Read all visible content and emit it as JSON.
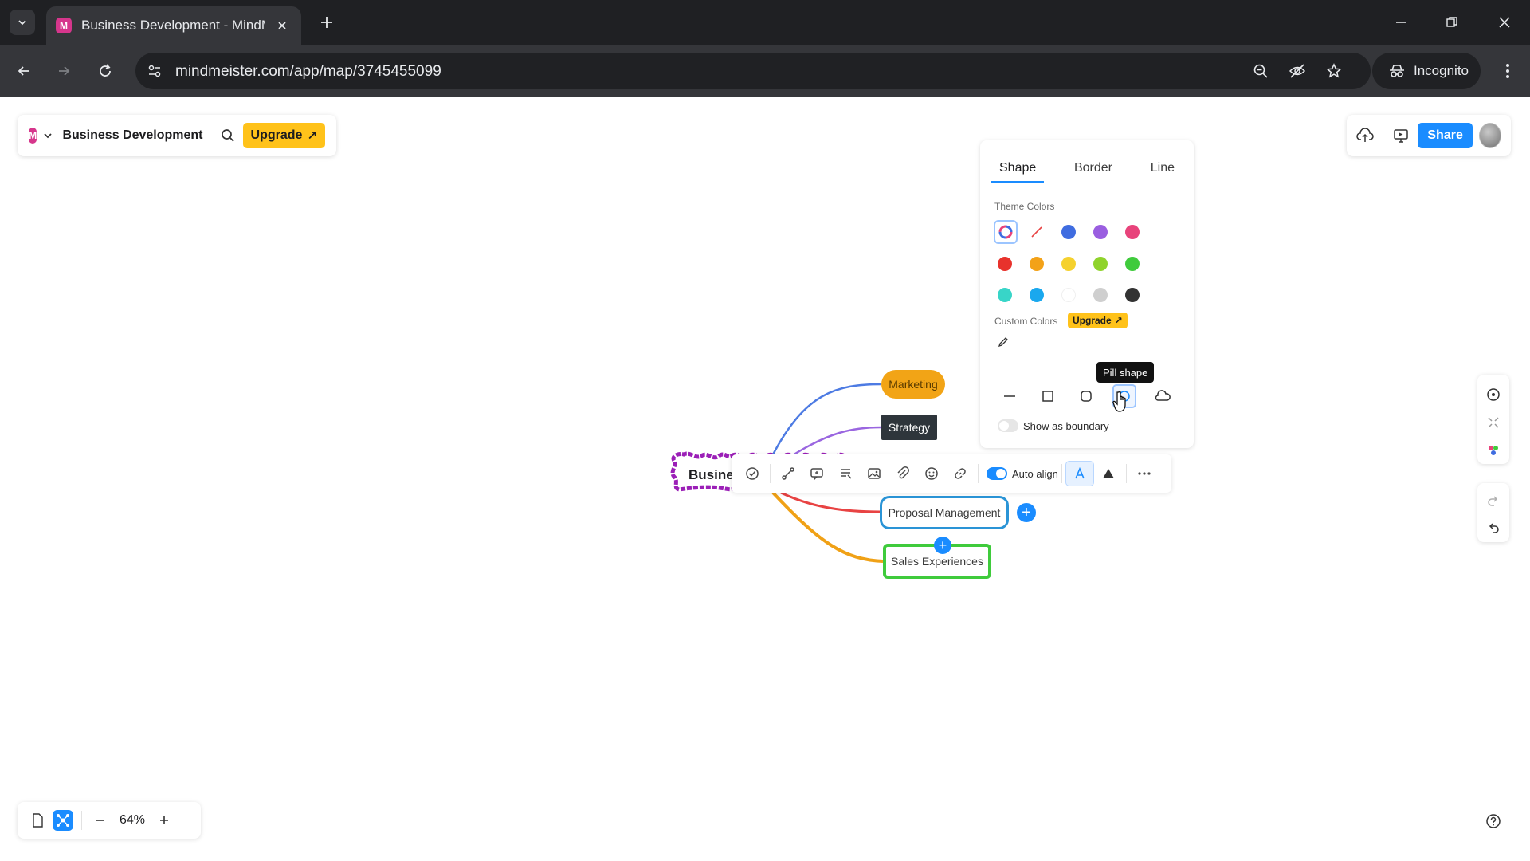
{
  "browser": {
    "tab_title": "Business Development - MindMeister",
    "url": "mindmeister.com/app/map/3745455099",
    "incognito_label": "Incognito"
  },
  "app": {
    "logo_letter": "M",
    "map_title": "Business Development",
    "upgrade_label": "Upgrade",
    "share_label": "Share"
  },
  "mindmap": {
    "root_label": "Busine",
    "nodes": {
      "marketing": "Marketing",
      "strategy": "Strategy",
      "proposal": "Proposal Management",
      "sales": "Sales Experiences"
    },
    "colors": {
      "marketing_line": "#4d7be3",
      "strategy_line": "#9a66e0",
      "proposal_line": "#e84343",
      "sales_line": "#f0a116",
      "root_border": "#9b1fb7"
    }
  },
  "node_toolbar": {
    "auto_align_label": "Auto align",
    "icons": [
      "check-circle-icon",
      "connect-icon",
      "comment-icon",
      "notes-icon",
      "image-icon",
      "attachment-icon",
      "emoji-icon",
      "link-icon",
      "style-icon",
      "triangle-icon",
      "more-icon"
    ]
  },
  "shape_panel": {
    "tabs": [
      "Shape",
      "Border",
      "Line"
    ],
    "active_tab": "Shape",
    "theme_colors_label": "Theme Colors",
    "theme_colors": [
      [
        "auto",
        "none",
        "#3f6ce0",
        "#9a5ee0",
        "#e8437b"
      ],
      [
        "#e8322c",
        "#f3a218",
        "#f5d12e",
        "#8fd32c",
        "#3fcb3c"
      ],
      [
        "#38d5c8",
        "#1aa8ee",
        "#ffffff",
        "#cfcfcf",
        "#333333"
      ]
    ],
    "custom_colors_label": "Custom Colors",
    "upgrade_label": "Upgrade",
    "shapes": [
      "line-shape",
      "rectangle-shape",
      "rounded-shape",
      "pill-shape",
      "cloud-shape"
    ],
    "selected_shape": "pill-shape",
    "tooltip": "Pill shape",
    "show_as_boundary_label": "Show as boundary",
    "show_as_boundary": false
  },
  "zoom": {
    "value": "64%"
  }
}
